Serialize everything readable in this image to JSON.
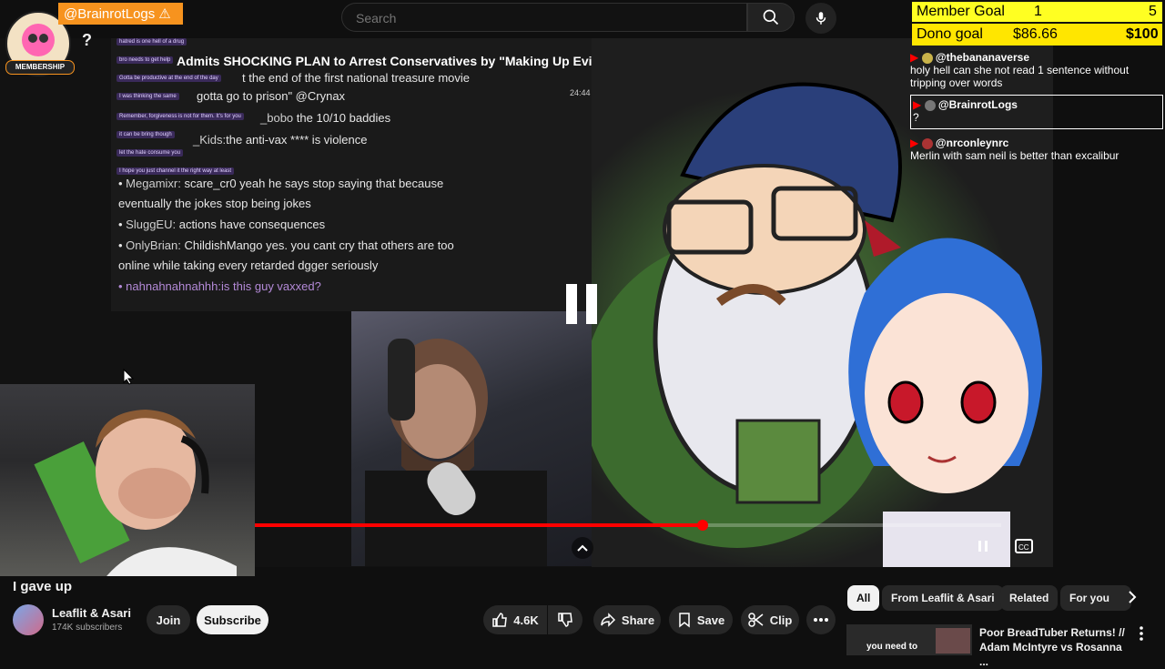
{
  "search": {
    "placeholder": "Search"
  },
  "overlay": {
    "brainrot_handle": "@BrainrotLogs",
    "membership_label": "MEMBERSHIP",
    "help_icon": "?",
    "member_goal": {
      "label": "Member Goal",
      "current": "1",
      "target": "5"
    },
    "dono_goal": {
      "label": "Dono goal",
      "current": "$86.66",
      "target": "$100"
    }
  },
  "stream_chat": [
    {
      "user": "@thebananaverse",
      "text": "holy hell can she not read 1 sentence without tripping over words"
    },
    {
      "user": "@BrainrotLogs",
      "text": "?"
    },
    {
      "user": "@nrconleynrc",
      "text": "Merlin with sam neil is better than excalibur"
    }
  ],
  "video": {
    "inner_title": "Admits SHOCKING PLAN to Arrest Conservatives by \"Making Up Evidence\"",
    "inner_time": "24:44",
    "inner_chat": [
      {
        "user": "",
        "text": "t the end of the first national treasure movie"
      },
      {
        "user": "",
        "text": "gotta go to prison\" @Crynax"
      },
      {
        "user": "_bobo",
        "text": "the 10/10 baddies"
      },
      {
        "user": "_Kids:",
        "text": "the anti-vax **** is violence"
      },
      {
        "user": "Megamixr:",
        "text": "scare_cr0 yeah he says stop saying that because"
      },
      {
        "user": "",
        "text": "eventually the jokes stop being jokes"
      },
      {
        "user": "SluggEU:",
        "text": "actions have consequences"
      },
      {
        "user": "OnlyBrian:",
        "text": "ChildishMango yes. you cant cry that others are too"
      },
      {
        "user": "",
        "text": "online while taking every retarded dgger seriously"
      },
      {
        "user": "nahnahnahnahhh:",
        "text": "is this guy vaxxed?"
      }
    ],
    "small_notes": [
      "hatred is one hell of a drug",
      "bro needs to get help",
      "Gotta be productive at the end of the day",
      "I was thinking the same",
      "Remember, forgiveness is not for them. It's for you",
      "it can be bring though",
      "let the hate consume you",
      "I hope you just channel it the right way at least"
    ],
    "progress": 0.6
  },
  "title": "I gave up",
  "channel": {
    "name": "Leaflit & Asari",
    "subscribers": "174K subscribers",
    "join_label": "Join",
    "subscribe_label": "Subscribe"
  },
  "actions": {
    "likes": "4.6K",
    "share": "Share",
    "save": "Save",
    "clip": "Clip"
  },
  "chips": [
    "All",
    "From Leaflit & Asari",
    "Related",
    "For you"
  ],
  "recommended": {
    "title": "Poor BreadTuber Returns! // Adam McIntyre vs Rosanna ...",
    "thumb_text": "you need to"
  }
}
